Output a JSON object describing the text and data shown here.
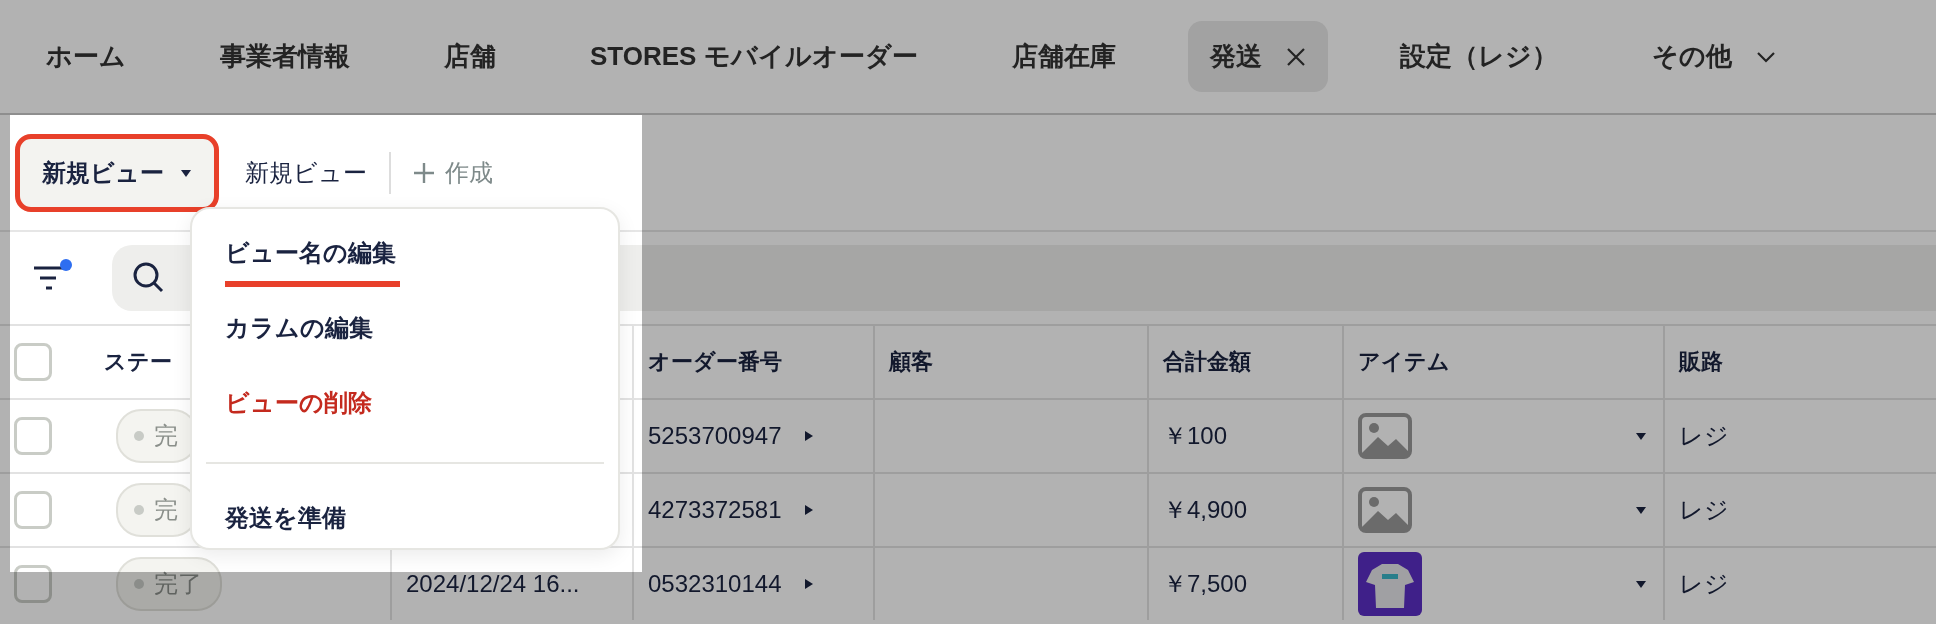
{
  "nav": {
    "tabs": [
      {
        "label": "ホーム",
        "selected": false,
        "kind": "link"
      },
      {
        "label": "事業者情報",
        "selected": false,
        "kind": "link"
      },
      {
        "label": "店舗",
        "selected": false,
        "kind": "link"
      },
      {
        "label": "STORES モバイルオーダー",
        "selected": false,
        "kind": "link"
      },
      {
        "label": "店舗在庫",
        "selected": false,
        "kind": "link"
      },
      {
        "label": "発送",
        "selected": true,
        "kind": "link"
      },
      {
        "label": "設定（レジ）",
        "selected": false,
        "kind": "link"
      },
      {
        "label": "その他",
        "selected": false,
        "kind": "menu"
      }
    ]
  },
  "views": {
    "current": {
      "label": "新規ビュー",
      "highlighted": true
    },
    "items": [
      "新規ビュー"
    ],
    "create": "作成"
  },
  "toolbar": {
    "filter_active": true
  },
  "menu": {
    "items": [
      {
        "kind": "normal",
        "label": "ビュー名の編集",
        "highlighted": true
      },
      {
        "kind": "normal",
        "label": "カラムの編集",
        "highlighted": false
      },
      {
        "kind": "danger",
        "label": "ビューの削除",
        "highlighted": false
      },
      {
        "kind": "divider"
      },
      {
        "kind": "normal",
        "label": "発送を準備",
        "highlighted": false
      }
    ]
  },
  "table": {
    "header": {
      "checked": false,
      "status": "ステー",
      "order": "オーダー番号",
      "customer": "顧客",
      "total": "合計金額",
      "item": "アイテム",
      "channel": "販路"
    },
    "rows": [
      {
        "checked": false,
        "status": "完",
        "order": "5253700947",
        "total": "￥100",
        "item": {
          "kind": "placeholder"
        },
        "channel": "レジ"
      },
      {
        "checked": false,
        "status": "完",
        "order": "4273372581",
        "total": "￥4,900",
        "item": {
          "kind": "placeholder"
        },
        "channel": "レジ"
      },
      {
        "checked": false,
        "status": "完了",
        "date": "2024/12/24 16...",
        "order": "0532310144",
        "total": "￥7,500",
        "channel": "レジ"
      }
    ]
  }
}
